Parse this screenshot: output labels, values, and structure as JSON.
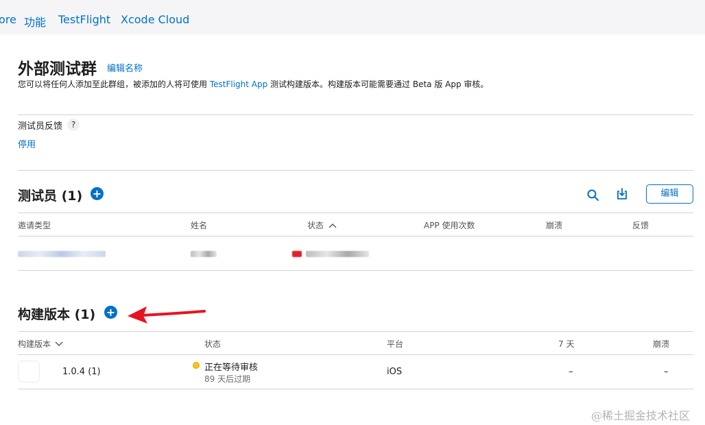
{
  "top_tabs": [
    {
      "label": "ore"
    },
    {
      "label": "功能"
    },
    {
      "label": "TestFlight"
    },
    {
      "label": "Xcode Cloud"
    }
  ],
  "group": {
    "title": "外部测试群",
    "edit_name": "编辑名称",
    "desc_prefix": "您可以将任何人添加至此群组，被添加的人将可使用 ",
    "desc_link": "TestFlight App",
    "desc_suffix": " 测试构建版本。构建版本可能需要通过 Beta 版 App 审核。"
  },
  "feedback": {
    "label": "测试员反馈",
    "help": "?",
    "toggle": "停用"
  },
  "testers": {
    "title": "测试员 (1)",
    "edit_label": "编辑",
    "columns": [
      "邀请类型",
      "姓名",
      "状态",
      "APP 使用次数",
      "崩溃",
      "反馈"
    ],
    "sort_indicator": "^"
  },
  "builds": {
    "title": "构建版本 (1)",
    "columns": [
      "构建版本",
      "状态",
      "平台",
      "7 天",
      "崩溃"
    ],
    "sort_indicator": "v",
    "rows": [
      {
        "version": "1.0.4 (1)",
        "status": "正在等待审核",
        "expires": "89 天后过期",
        "platform": "iOS",
        "seven_days": "–",
        "crashes": "–"
      }
    ]
  },
  "icons": [
    "plus-circle-icon",
    "search-icon",
    "download-icon",
    "question-icon",
    "arrow-annotation"
  ],
  "colors": {
    "accent": "#0070c9",
    "arrow": "#e8131f",
    "pending": "#f5c518"
  },
  "watermark": "@稀土掘金技术社区"
}
